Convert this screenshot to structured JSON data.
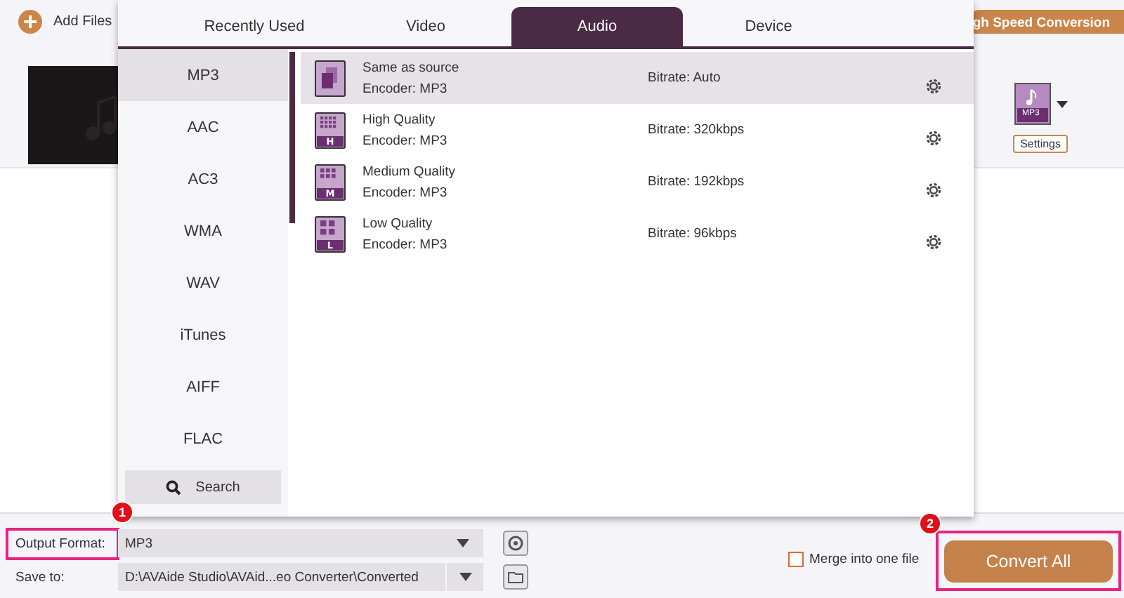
{
  "toolbar": {
    "add_files": "Add Files",
    "speed_button": "gh Speed Conversion",
    "profile_label": "MP3",
    "settings_button": "Settings"
  },
  "popup": {
    "tabs": [
      {
        "label": "Recently Used",
        "selected": false
      },
      {
        "label": "Video",
        "selected": false
      },
      {
        "label": "Audio",
        "selected": true
      },
      {
        "label": "Device",
        "selected": false
      }
    ],
    "formats": [
      {
        "label": "MP3",
        "selected": true
      },
      {
        "label": "AAC",
        "selected": false
      },
      {
        "label": "AC3",
        "selected": false
      },
      {
        "label": "WMA",
        "selected": false
      },
      {
        "label": "WAV",
        "selected": false
      },
      {
        "label": "iTunes",
        "selected": false
      },
      {
        "label": "AIFF",
        "selected": false
      },
      {
        "label": "FLAC",
        "selected": false
      }
    ],
    "search": "Search",
    "presets": [
      {
        "kind": "same",
        "name": "Same as source",
        "encoder": "Encoder: MP3",
        "bitrate": "Bitrate: Auto",
        "selected": true
      },
      {
        "kind": "high",
        "badge": "H",
        "name": "High Quality",
        "encoder": "Encoder: MP3",
        "bitrate": "Bitrate: 320kbps",
        "selected": false
      },
      {
        "kind": "medium",
        "badge": "M",
        "name": "Medium Quality",
        "encoder": "Encoder: MP3",
        "bitrate": "Bitrate: 192kbps",
        "selected": false
      },
      {
        "kind": "low",
        "badge": "L",
        "name": "Low Quality",
        "encoder": "Encoder: MP3",
        "bitrate": "Bitrate: 96kbps",
        "selected": false
      }
    ]
  },
  "bottom": {
    "output_format": {
      "label": "Output Format:",
      "value": "MP3",
      "callout": "1"
    },
    "save_to": {
      "label": "Save to:",
      "value": "D:\\AVAide Studio\\AVAid...eo Converter\\Converted"
    },
    "merge": {
      "label": "Merge into one file",
      "checked": false
    },
    "convert": {
      "label": "Convert All",
      "callout": "2"
    }
  }
}
